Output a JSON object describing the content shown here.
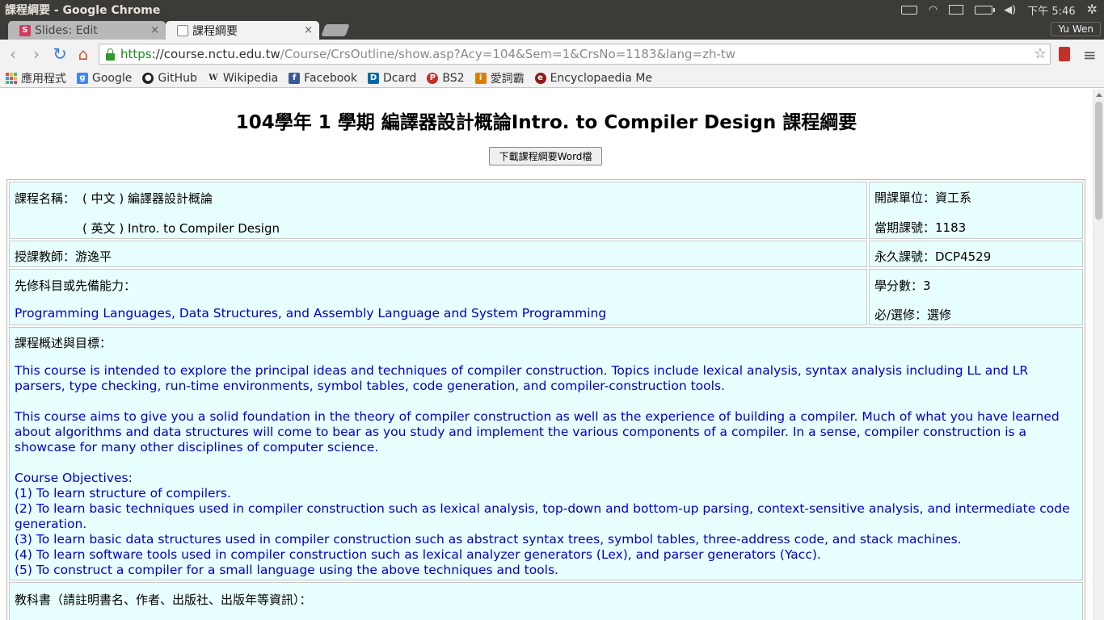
{
  "os": {
    "window_title": "課程綱要 - Google Chrome",
    "clock": "下午 5:46"
  },
  "tabs": [
    {
      "label": "Slides: Edit",
      "favicon": "S"
    },
    {
      "label": "課程綱要"
    }
  ],
  "profile": "Yu Wen",
  "address": {
    "scheme": "https",
    "host": "://course.nctu.edu.tw",
    "path": "/Course/CrsOutline/show.asp?Acy=104&Sem=1&CrsNo=1183&lang=zh-tw"
  },
  "bookmarks": [
    {
      "label": "應用程式",
      "icon": "apps-grid-icon"
    },
    {
      "label": "Google",
      "icon": "google-icon",
      "badge": "g",
      "color": "#4285f4"
    },
    {
      "label": "GitHub",
      "icon": "github-icon",
      "badge": "●",
      "color": "#222222"
    },
    {
      "label": "Wikipedia",
      "icon": "wikipedia-icon",
      "badge": "W",
      "color": "#555555"
    },
    {
      "label": "Facebook",
      "icon": "facebook-icon",
      "badge": "f",
      "color": "#3b5998"
    },
    {
      "label": "Dcard",
      "icon": "dcard-icon",
      "badge": "D",
      "color": "#006aa6"
    },
    {
      "label": "BS2",
      "icon": "bs2-icon",
      "badge": "P",
      "color": "#c4302b"
    },
    {
      "label": "愛詞霸",
      "icon": "iciba-icon",
      "badge": "i",
      "color": "#e07b00"
    },
    {
      "label": "Encyclopaedia Me",
      "icon": "encyclopaedia-icon",
      "badge": "e",
      "color": "#8b1a1a"
    }
  ],
  "page": {
    "title": "104學年 1 學期 編譯器設計概論Intro. to Compiler Design 課程綱要",
    "download_button": "下載課程綱要Word檔",
    "course_name_label": "課程名稱：",
    "course_name_zh": "( 中文 ) 編譯器設計概論",
    "course_name_en": "( 英文 ) Intro. to Compiler Design",
    "department": "開課單位：資工系",
    "current_code": "當期課號：1183",
    "instructor": "授課教師：游逸平",
    "permanent_code": "永久課號：DCP4529",
    "prereq_label": "先修科目或先備能力：",
    "prereq_text": "Programming Languages, Data Structures, and Assembly Language and System Programming",
    "credits": "學分數：3",
    "required": "必/選修：選修",
    "overview_label": "課程概述與目標：",
    "overview_p1": "This course is intended to explore the principal ideas and techniques of compiler construction. Topics include lexical analysis, syntax analysis including LL and LR parsers, type checking, run-time environments, symbol tables, code generation, and compiler-construction tools.",
    "overview_p2": "This course aims to give you a solid foundation in the theory of compiler construction as well as the experience of building a compiler. Much of what you have learned about algorithms and data structures will come to bear as you study and implement the various components of a compiler. In a sense, compiler construction is a showcase for many other disciplines of computer science.",
    "objectives_heading": "Course Objectives:",
    "objectives": [
      "(1) To learn structure of compilers.",
      "(2) To learn basic techniques used in compiler construction such as lexical analysis, top-down and bottom-up parsing, context-sensitive analysis, and intermediate code generation.",
      "(3) To learn basic data structures used in compiler construction such as abstract syntax trees, symbol tables, three-address code, and stack machines.",
      "(4) To learn software tools used in compiler construction such as lexical analyzer generators (Lex), and parser generators (Yacc).",
      "(5) To construct a compiler for a small language using the above techniques and tools."
    ],
    "textbook_label": "教科書（請註明書名、作者、出版社、出版年等資訊）："
  }
}
